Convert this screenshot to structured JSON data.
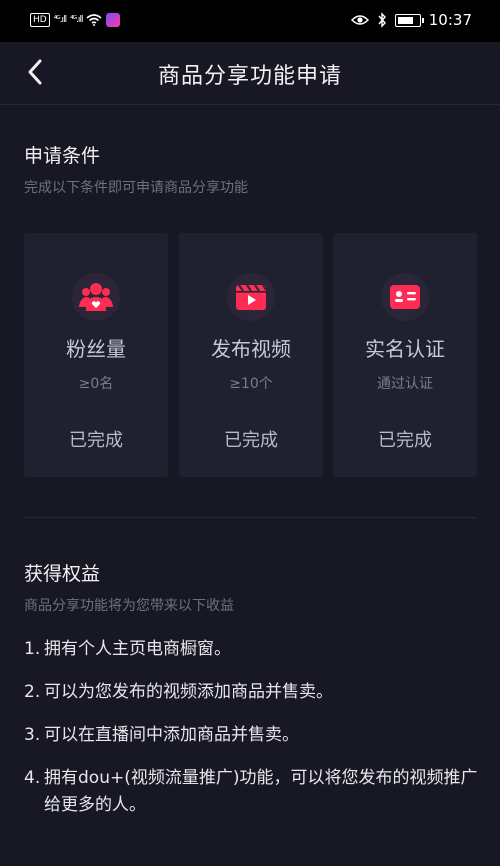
{
  "status_bar": {
    "left_badge": "HD",
    "signal_1": "⁴ᴳ.ıll",
    "signal_2": "⁴ᴳ.ıll",
    "time": "10:37"
  },
  "header": {
    "title": "商品分享功能申请"
  },
  "conditions": {
    "title": "申请条件",
    "subtitle": "完成以下条件即可申请商品分享功能",
    "cards": [
      {
        "icon": "fans-icon",
        "label": "粉丝量",
        "requirement": "≥0名",
        "status": "已完成"
      },
      {
        "icon": "video-icon",
        "label": "发布视频",
        "requirement": "≥10个",
        "status": "已完成"
      },
      {
        "icon": "id-card-icon",
        "label": "实名认证",
        "requirement": "通过认证",
        "status": "已完成"
      }
    ]
  },
  "benefits": {
    "title": "获得权益",
    "subtitle": "商品分享功能将为您带来以下收益",
    "items": [
      {
        "num": "1.",
        "text": "拥有个人主页电商橱窗。"
      },
      {
        "num": "2.",
        "text": "可以为您发布的视频添加商品并售卖。"
      },
      {
        "num": "3.",
        "text": "可以在直播间中添加商品并售卖。"
      },
      {
        "num": "4.",
        "text": "拥有dou+(视频流量推广)功能，可以将您发布的视频推广给更多的人。"
      }
    ]
  },
  "colors": {
    "background": "#171823",
    "card": "#1f2030",
    "accent": "#fe2c55"
  }
}
